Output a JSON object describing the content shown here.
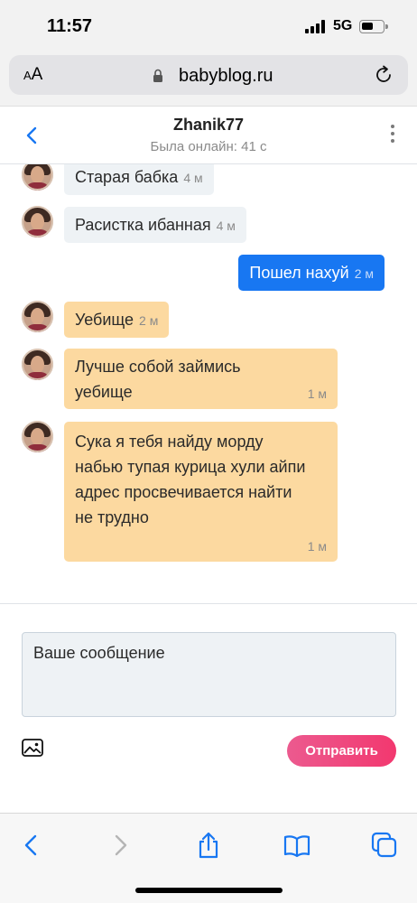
{
  "status_bar": {
    "time": "11:57",
    "network": "5G"
  },
  "browser": {
    "text_size_button": "AA",
    "domain": "babyblog.ru"
  },
  "chat": {
    "username": "Zhanik77",
    "presence": "Была онлайн: 41 с"
  },
  "messages": [
    {
      "sender": "other",
      "text": "Старая бабка",
      "time": "4 м"
    },
    {
      "sender": "other",
      "text": "Расистка ибанная",
      "time": "4 м"
    },
    {
      "sender": "me",
      "text": "Пошел нахуй",
      "time": "2 м"
    },
    {
      "sender": "other",
      "text": "Уебище",
      "time": "2 м"
    },
    {
      "sender": "other",
      "lines": [
        "Лучше собой займись",
        "уебище"
      ],
      "time": "1 м"
    },
    {
      "sender": "other",
      "lines": [
        "Сука я тебя найду морду",
        "набью тупая курица хули айпи",
        "адрес просвечивается найти",
        "не трудно"
      ],
      "time": "1 м"
    }
  ],
  "composer": {
    "placeholder": "Ваше сообщение",
    "send_label": "Отправить"
  },
  "colors": {
    "accent_blue": "#1877f2",
    "incoming_gray": "#eef2f5",
    "incoming_highlight": "#fcd9a0",
    "send_button": "#f2386f"
  }
}
